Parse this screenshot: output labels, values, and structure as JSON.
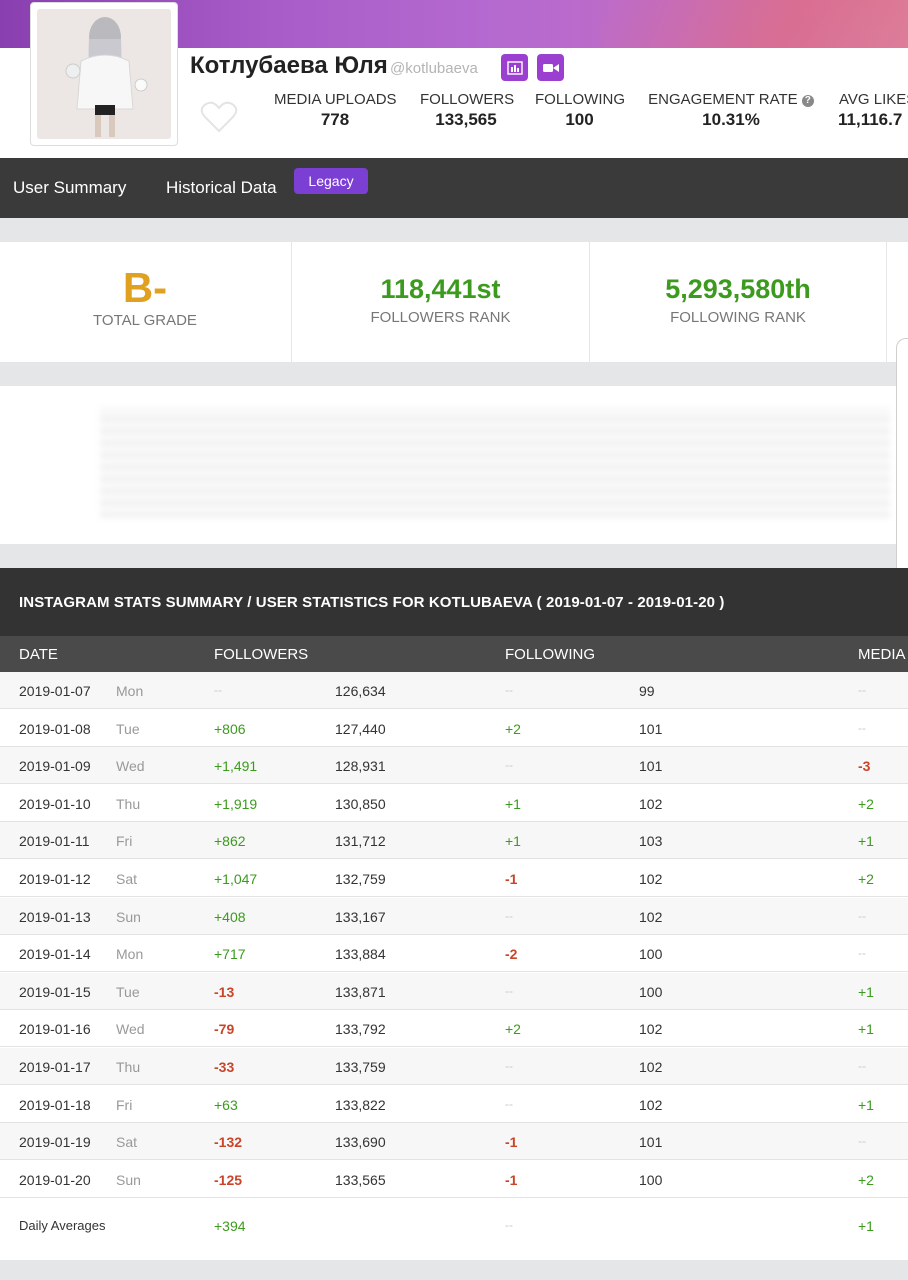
{
  "profile": {
    "name": "Котлубаева Юля",
    "handle": "@kotlubaeva",
    "stats": [
      {
        "label": "MEDIA UPLOADS",
        "value": "778"
      },
      {
        "label": "FOLLOWERS",
        "value": "133,565"
      },
      {
        "label": "FOLLOWING",
        "value": "100"
      },
      {
        "label": "ENGAGEMENT RATE",
        "value": "10.31%"
      },
      {
        "label": "AVG LIKES",
        "value": "11,116.7"
      }
    ]
  },
  "nav": {
    "user_summary": "User Summary",
    "historical_data": "Historical Data",
    "legacy": "Legacy"
  },
  "ranks": {
    "grade": "B-",
    "grade_label": "TOTAL GRADE",
    "followers_rank": "118,441st",
    "followers_rank_label": "FOLLOWERS RANK",
    "following_rank": "5,293,580th",
    "following_rank_label": "FOLLOWING RANK"
  },
  "summary": {
    "title": "INSTAGRAM STATS SUMMARY / USER STATISTICS FOR KOTLUBAEVA ( 2019-01-07 - 2019-01-20 )",
    "headers": {
      "date": "DATE",
      "followers": "FOLLOWERS",
      "following": "FOLLOWING",
      "media": "MEDIA"
    },
    "rows": [
      {
        "date": "2019-01-07",
        "day": "Mon",
        "fd": "--",
        "ft": "126,634",
        "gd": "--",
        "gt": "99",
        "md": "--"
      },
      {
        "date": "2019-01-08",
        "day": "Tue",
        "fd": "+806",
        "ft": "127,440",
        "gd": "+2",
        "gt": "101",
        "md": "--"
      },
      {
        "date": "2019-01-09",
        "day": "Wed",
        "fd": "+1,491",
        "ft": "128,931",
        "gd": "--",
        "gt": "101",
        "md": "-3"
      },
      {
        "date": "2019-01-10",
        "day": "Thu",
        "fd": "+1,919",
        "ft": "130,850",
        "gd": "+1",
        "gt": "102",
        "md": "+2"
      },
      {
        "date": "2019-01-11",
        "day": "Fri",
        "fd": "+862",
        "ft": "131,712",
        "gd": "+1",
        "gt": "103",
        "md": "+1"
      },
      {
        "date": "2019-01-12",
        "day": "Sat",
        "fd": "+1,047",
        "ft": "132,759",
        "gd": "-1",
        "gt": "102",
        "md": "+2"
      },
      {
        "date": "2019-01-13",
        "day": "Sun",
        "fd": "+408",
        "ft": "133,167",
        "gd": "--",
        "gt": "102",
        "md": "--"
      },
      {
        "date": "2019-01-14",
        "day": "Mon",
        "fd": "+717",
        "ft": "133,884",
        "gd": "-2",
        "gt": "100",
        "md": "--"
      },
      {
        "date": "2019-01-15",
        "day": "Tue",
        "fd": "-13",
        "ft": "133,871",
        "gd": "--",
        "gt": "100",
        "md": "+1"
      },
      {
        "date": "2019-01-16",
        "day": "Wed",
        "fd": "-79",
        "ft": "133,792",
        "gd": "+2",
        "gt": "102",
        "md": "+1"
      },
      {
        "date": "2019-01-17",
        "day": "Thu",
        "fd": "-33",
        "ft": "133,759",
        "gd": "--",
        "gt": "102",
        "md": "--"
      },
      {
        "date": "2019-01-18",
        "day": "Fri",
        "fd": "+63",
        "ft": "133,822",
        "gd": "--",
        "gt": "102",
        "md": "+1"
      },
      {
        "date": "2019-01-19",
        "day": "Sat",
        "fd": "-132",
        "ft": "133,690",
        "gd": "-1",
        "gt": "101",
        "md": "--"
      },
      {
        "date": "2019-01-20",
        "day": "Sun",
        "fd": "-125",
        "ft": "133,565",
        "gd": "-1",
        "gt": "100",
        "md": "+2"
      }
    ],
    "averages": {
      "label": "Daily Averages",
      "fd": "+394",
      "gd": "--",
      "md": "+1"
    }
  },
  "colors": {
    "accent": "#7b3fd4",
    "positive": "#3c9b1e",
    "negative": "#c8452a",
    "grade": "#e0a020"
  }
}
